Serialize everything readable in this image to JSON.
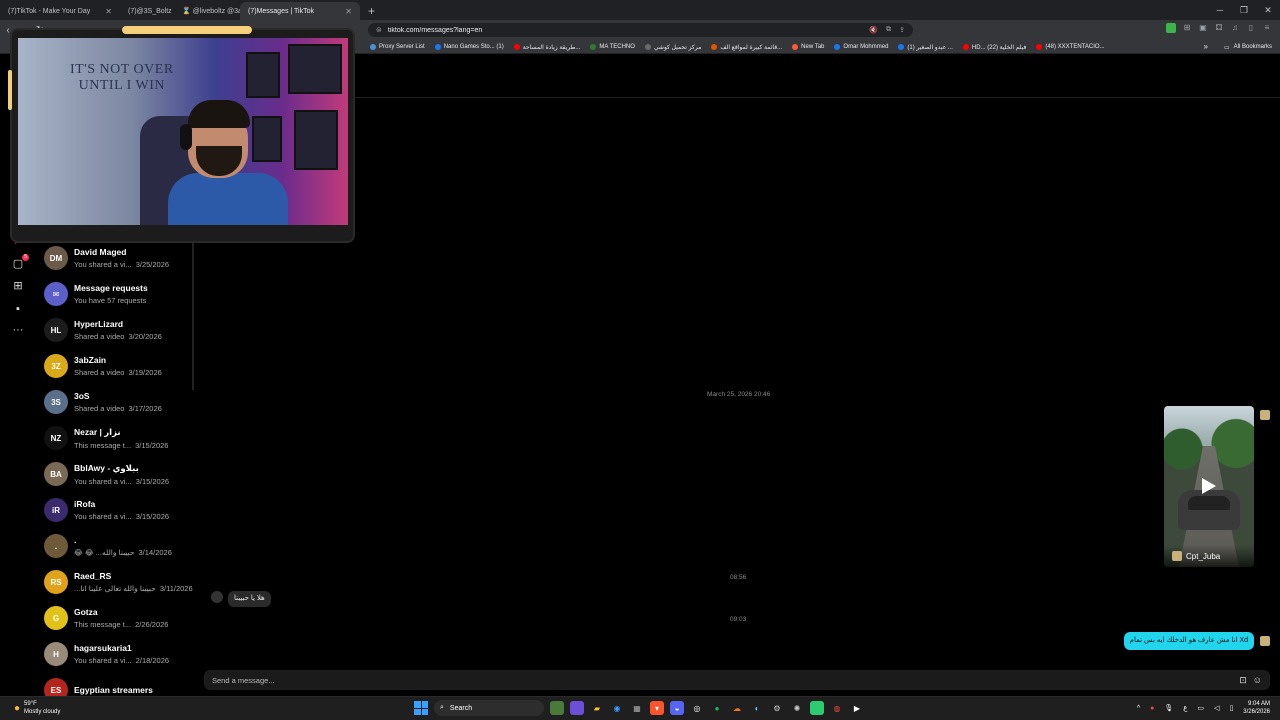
{
  "browser": {
    "tabs": [
      {
        "title": "(7)TikTok - Make Your Day"
      },
      {
        "title": "(7)@3S_Boltz ㅤ ⌛ @liveboltz @3aW..."
      },
      {
        "title": "(7)Messages | TikTok"
      }
    ],
    "url": "tiktok.com/messages?lang=en",
    "bookmarks": [
      {
        "label": "Proxy Server List",
        "color": "#4a90d9"
      },
      {
        "label": "Nano Games Sto... (1)",
        "color": "#1877f2"
      },
      {
        "label": "طريقة زيادة المساحة...",
        "color": "#ff0000"
      },
      {
        "label": "MA TECHNO",
        "color": "#2e7d32"
      },
      {
        "label": "مركز تحميل كوشي",
        "color": "#6a6a6a"
      },
      {
        "label": "قائمة كبيرة لمواقع الف...",
        "color": "#e65100"
      },
      {
        "label": "New Tab",
        "color": "#ff5a36"
      },
      {
        "label": "Omar Mohmmed",
        "color": "#1877f2"
      },
      {
        "label": "(1) عبدو الصغير ...",
        "color": "#1877f2"
      },
      {
        "label": "HD... فيلم الخلية (22)",
        "color": "#ff0000"
      },
      {
        "label": "(48) XXXTENTACIO...",
        "color": "#ff0000"
      }
    ],
    "all_bookmarks": "All Bookmarks"
  },
  "rail": {
    "inbox_badge": "5"
  },
  "conversations": [
    {
      "name": "David Maged",
      "preview": "You shared a vi...",
      "date": "3/25/2026",
      "color": "#6b5a4a",
      "initials": "DM"
    },
    {
      "name": "Message requests",
      "preview": "You have 57 requests",
      "date": "",
      "color": "#5b5fc7",
      "initials": "✉"
    },
    {
      "name": "HyperLizard",
      "preview": "Shared a video",
      "date": "3/20/2026",
      "color": "#1c1c1c",
      "initials": "HL"
    },
    {
      "name": "3abZain",
      "preview": "Shared a video",
      "date": "3/19/2026",
      "color": "#d9a91a",
      "initials": "3Z"
    },
    {
      "name": "3oS",
      "preview": "Shared a video",
      "date": "3/17/2026",
      "color": "#5a6f8a",
      "initials": "3S"
    },
    {
      "name": "Nezar | نزار",
      "preview": "This message t...",
      "date": "3/15/2026",
      "color": "#111111",
      "initials": "NZ"
    },
    {
      "name": "BblAwy - ببلاوي",
      "preview": "You shared a vi...",
      "date": "3/15/2026",
      "color": "#7a6a55",
      "initials": "BA"
    },
    {
      "name": "iRofa",
      "preview": "You shared a vi...",
      "date": "3/15/2026",
      "color": "#3b2a6e",
      "initials": "iR"
    },
    {
      "name": ".",
      "preview": "😂 😂 ...حبيبنا والله",
      "date": "3/14/2026",
      "color": "#6e5a3a",
      "initials": "."
    },
    {
      "name": "Raed_RS",
      "preview": "...حبيبنا والله تعالى علينا انا",
      "date": "3/11/2026",
      "color": "#e0a21a",
      "initials": "RS"
    },
    {
      "name": "Gotza",
      "preview": "This message t...",
      "date": "2/26/2026",
      "color": "#e2c21a",
      "initials": "G"
    },
    {
      "name": "hagarsukaria1",
      "preview": "You shared a vi...",
      "date": "2/18/2026",
      "color": "#9a8a7a",
      "initials": "H"
    },
    {
      "name": "Egyptian streamers",
      "preview": "",
      "date": "",
      "color": "#b3261e",
      "initials": "ES"
    }
  ],
  "chat": {
    "timestamp_1": "March 25, 2026 20:46",
    "video_author": "Cpt_Juba",
    "timestamp_2": "08:56",
    "incoming_message": "هلا يا حبيبنا",
    "timestamp_3": "09:03",
    "outgoing_message": "Xd انا مش عارف هو الدخلك ايه بس تمام",
    "composer_placeholder": "Send a message..."
  },
  "webcam": {
    "wall_text_line1": "IT'S NOT OVER",
    "wall_text_line2": "UNTIL I WIN"
  },
  "taskbar": {
    "temperature": "59°F",
    "weather": "Mostly cloudy",
    "search_label": "Search",
    "time": "9:04 AM",
    "date": "3/26/2026",
    "lang": "ع"
  }
}
